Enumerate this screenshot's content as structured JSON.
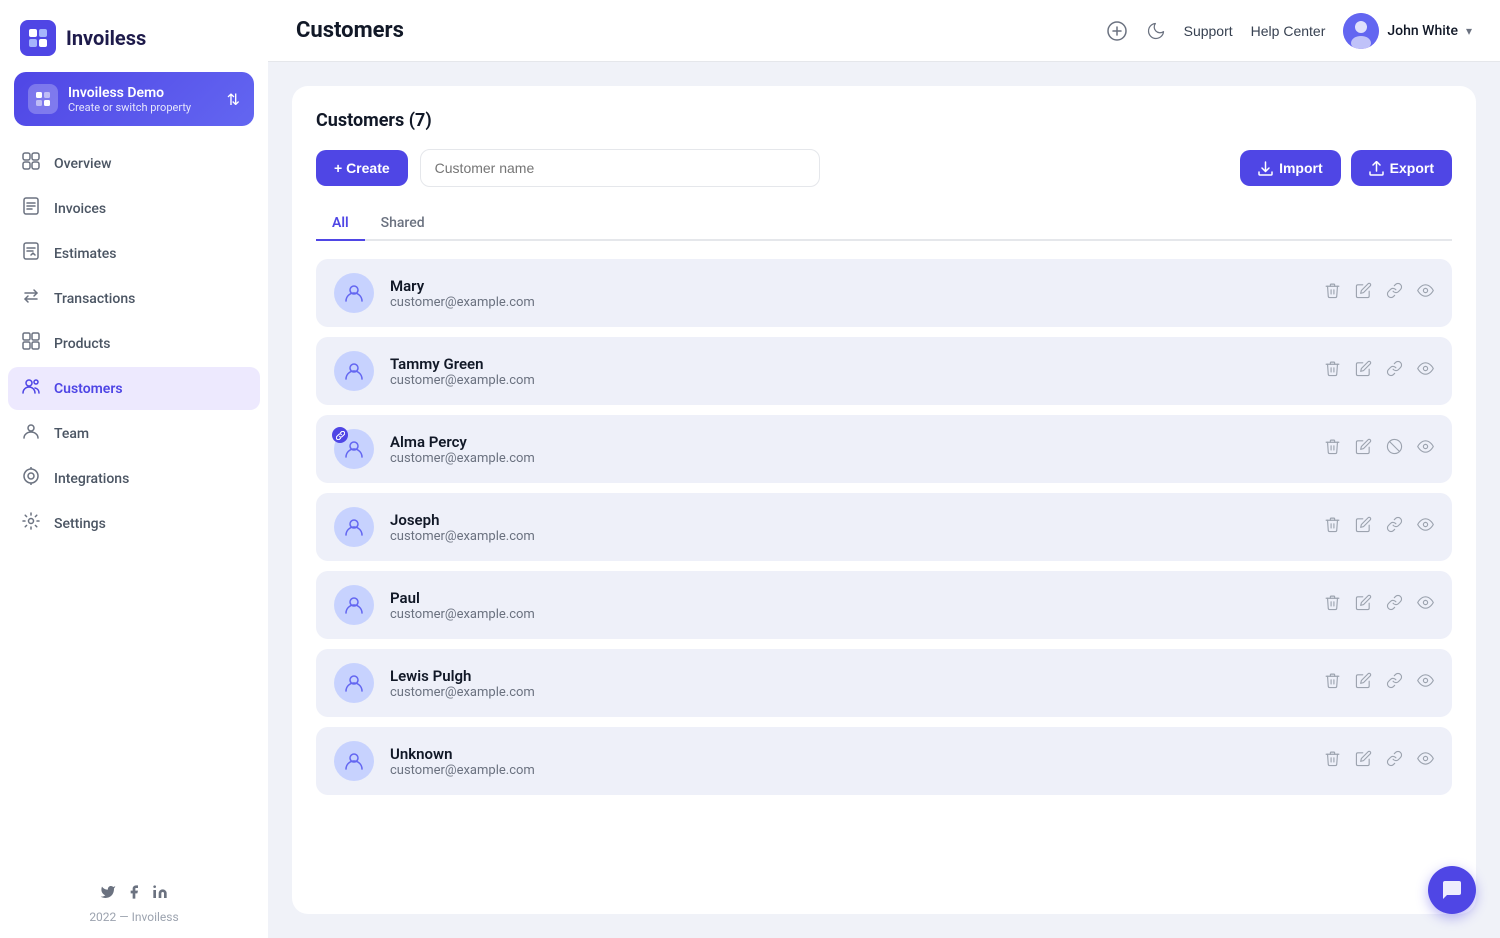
{
  "sidebar": {
    "logo": "Invoiless",
    "property": {
      "name": "Invoiless Demo",
      "sub": "Create or switch property"
    },
    "nav": [
      {
        "id": "overview",
        "label": "Overview",
        "icon": "⊙"
      },
      {
        "id": "invoices",
        "label": "Invoices",
        "icon": "🗒"
      },
      {
        "id": "estimates",
        "label": "Estimates",
        "icon": "📋"
      },
      {
        "id": "transactions",
        "label": "Transactions",
        "icon": "↕"
      },
      {
        "id": "products",
        "label": "Products",
        "icon": "⊞"
      },
      {
        "id": "customers",
        "label": "Customers",
        "icon": "👥",
        "active": true
      },
      {
        "id": "team",
        "label": "Team",
        "icon": "👤"
      },
      {
        "id": "integrations",
        "label": "Integrations",
        "icon": "⚙"
      },
      {
        "id": "settings",
        "label": "Settings",
        "icon": "⚙"
      }
    ],
    "footer": {
      "year": "2022",
      "brand": "Invoiless"
    }
  },
  "topbar": {
    "title": "Customers",
    "support_label": "Support",
    "help_label": "Help Center",
    "user_name": "John White"
  },
  "main": {
    "card_header": "Customers (7)",
    "search_placeholder": "Customer name",
    "create_label": "+ Create",
    "import_label": "Import",
    "export_label": "Export",
    "tabs": [
      {
        "id": "all",
        "label": "All",
        "active": true
      },
      {
        "id": "shared",
        "label": "Shared",
        "active": false
      }
    ],
    "customers": [
      {
        "id": 1,
        "name": "Mary",
        "email": "customer@example.com",
        "badge": false
      },
      {
        "id": 2,
        "name": "Tammy Green",
        "email": "customer@example.com",
        "badge": false
      },
      {
        "id": 3,
        "name": "Alma Percy",
        "email": "customer@example.com",
        "badge": true
      },
      {
        "id": 4,
        "name": "Joseph",
        "email": "customer@example.com",
        "badge": false
      },
      {
        "id": 5,
        "name": "Paul",
        "email": "customer@example.com",
        "badge": false
      },
      {
        "id": 6,
        "name": "Lewis Pulgh",
        "email": "customer@example.com",
        "badge": false
      },
      {
        "id": 7,
        "name": "Unknown",
        "email": "customer@example.com",
        "badge": false
      }
    ]
  },
  "icons": {
    "delete": "🗑",
    "edit": "✎",
    "link": "🔗",
    "view": "👁",
    "ban": "⊘",
    "plus": "+",
    "moon": "🌙",
    "upload": "↑",
    "download": "↓",
    "chat": "💬",
    "twitter": "🐦",
    "facebook": "f",
    "linkedin": "in",
    "user": "👤",
    "chevron_down": "▾"
  }
}
